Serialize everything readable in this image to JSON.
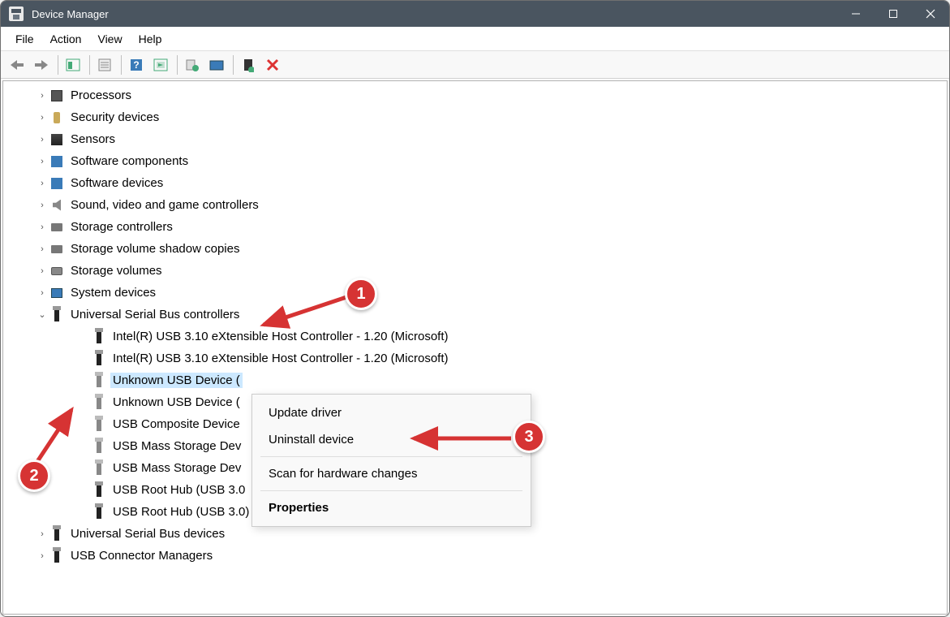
{
  "window": {
    "title": "Device Manager"
  },
  "menu": {
    "file": "File",
    "action": "Action",
    "view": "View",
    "help": "Help"
  },
  "tree": {
    "items": [
      {
        "expander": "›",
        "icon": "chip",
        "label": "Processors",
        "level": 1
      },
      {
        "expander": "›",
        "icon": "key",
        "label": "Security devices",
        "level": 1
      },
      {
        "expander": "›",
        "icon": "sensor",
        "label": "Sensors",
        "level": 1
      },
      {
        "expander": "›",
        "icon": "sw",
        "label": "Software components",
        "level": 1
      },
      {
        "expander": "›",
        "icon": "sw",
        "label": "Software devices",
        "level": 1
      },
      {
        "expander": "›",
        "icon": "sound",
        "label": "Sound, video and game controllers",
        "level": 1
      },
      {
        "expander": "›",
        "icon": "storage",
        "label": "Storage controllers",
        "level": 1
      },
      {
        "expander": "›",
        "icon": "storage",
        "label": "Storage volume shadow copies",
        "level": 1
      },
      {
        "expander": "›",
        "icon": "disk",
        "label": "Storage volumes",
        "level": 1
      },
      {
        "expander": "›",
        "icon": "sys",
        "label": "System devices",
        "level": 1
      },
      {
        "expander": "⌄",
        "icon": "usb",
        "label": "Universal Serial Bus controllers",
        "level": 1
      },
      {
        "expander": "",
        "icon": "usb",
        "label": "Intel(R) USB 3.10 eXtensible Host Controller - 1.20 (Microsoft)",
        "level": 2
      },
      {
        "expander": "",
        "icon": "usb",
        "label": "Intel(R) USB 3.10 eXtensible Host Controller - 1.20 (Microsoft)",
        "level": 2
      },
      {
        "expander": "",
        "icon": "usb-g",
        "label": "Unknown USB Device (",
        "level": 2,
        "selected": true
      },
      {
        "expander": "",
        "icon": "usb-g",
        "label": "Unknown USB Device (",
        "level": 2
      },
      {
        "expander": "",
        "icon": "usb-g",
        "label": "USB Composite Device",
        "level": 2
      },
      {
        "expander": "",
        "icon": "usb-g",
        "label": "USB Mass Storage Dev",
        "level": 2
      },
      {
        "expander": "",
        "icon": "usb-g",
        "label": "USB Mass Storage Dev",
        "level": 2
      },
      {
        "expander": "",
        "icon": "usb",
        "label": "USB Root Hub (USB 3.0",
        "level": 2
      },
      {
        "expander": "",
        "icon": "usb",
        "label": "USB Root Hub (USB 3.0)",
        "level": 2
      },
      {
        "expander": "›",
        "icon": "usb",
        "label": "Universal Serial Bus devices",
        "level": 1
      },
      {
        "expander": "›",
        "icon": "usb",
        "label": "USB Connector Managers",
        "level": 1
      }
    ]
  },
  "context_menu": {
    "update": "Update driver",
    "uninstall": "Uninstall device",
    "scan": "Scan for hardware changes",
    "properties": "Properties"
  },
  "badges": {
    "b1": "1",
    "b2": "2",
    "b3": "3"
  }
}
